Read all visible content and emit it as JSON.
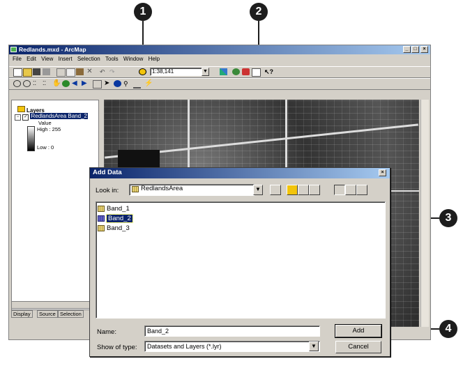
{
  "callouts": [
    "1",
    "2",
    "3",
    "4"
  ],
  "window": {
    "title": "Redlands.mxd - ArcMap",
    "controls": [
      "_",
      "□",
      "×"
    ]
  },
  "menu": [
    "File",
    "Edit",
    "View",
    "Insert",
    "Selection",
    "Tools",
    "Window",
    "Help"
  ],
  "toolbar": {
    "scale": "1:38,141"
  },
  "toc": {
    "root": "Layers",
    "layer": "RedlandsArea Band_2",
    "value_label": "Value",
    "high": "High : 255",
    "low": "Low : 0",
    "tabs": [
      "Display",
      "Source",
      "Selection"
    ]
  },
  "dialog": {
    "title": "Add Data",
    "look_in_label": "Look in:",
    "look_in_value": "RedlandsArea",
    "items": [
      "Band_1",
      "Band_2",
      "Band_3"
    ],
    "selected_item": "Band_2",
    "name_label": "Name:",
    "name_value": "Band_2",
    "type_label": "Show of type:",
    "type_value": "Datasets and Layers (*.lyr)",
    "add_button": "Add",
    "cancel_button": "Cancel",
    "close": "×"
  },
  "colors": {
    "titlebar": "#0a246a",
    "selection": "#0a246a"
  }
}
